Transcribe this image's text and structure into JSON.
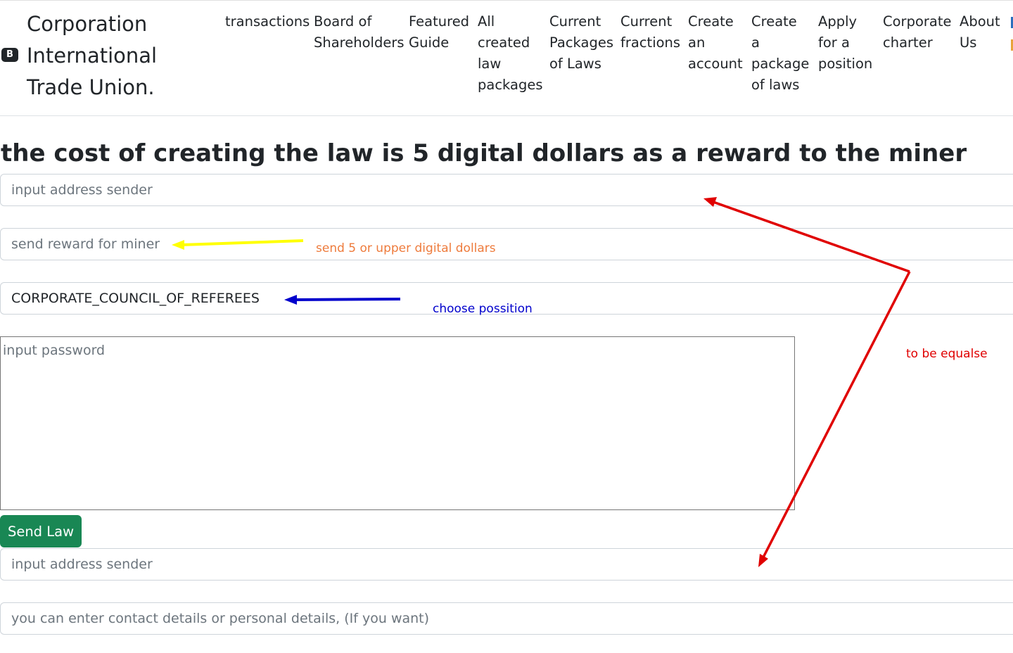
{
  "brand": {
    "icon_letter": "B",
    "name": "Corporation International Trade Union."
  },
  "nav": {
    "links": [
      "transactions",
      "Board of Shareholders",
      "Featured Guide",
      "All created law packages",
      "Current Packages of Laws",
      "Current fractions",
      "Create an account",
      "Create a package of laws",
      "Apply for a position",
      "Corporate charter",
      "About Us"
    ]
  },
  "main": {
    "heading": "the cost of creating the law is 5 digital dollars as a reward to the miner",
    "form": {
      "sender_address_placeholder": "input address sender",
      "reward_placeholder": "send reward for miner",
      "position_value": "CORPORATE_COUNCIL_OF_REFEREES",
      "password_placeholder": "input password",
      "send_button": "Send Law",
      "sender_address_2_placeholder": "input address sender",
      "contact_placeholder": "you can enter contact details or personal details, (If you want)"
    }
  },
  "annotations": {
    "reward_note": "send 5 or upper digital dollars",
    "position_note": "choose possition",
    "equal_note": "to be equalse",
    "colors": {
      "yellow": "#ffff00",
      "orange": "#ee7b3c",
      "blue": "#0000cc",
      "red": "#e00000"
    }
  }
}
